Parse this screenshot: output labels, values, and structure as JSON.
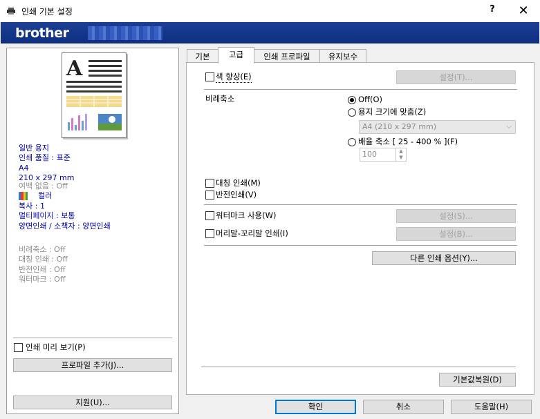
{
  "window": {
    "title": "인쇄 기본 설정",
    "help": "?",
    "close": "✕"
  },
  "banner": {
    "brand": "brother"
  },
  "summary": {
    "lines_blue": [
      "일반 용지",
      "인쇄 품질 : 표준",
      "A4",
      "210 x 297 mm"
    ],
    "borderless": "여백 없음 : Off",
    "color": "컬러",
    "lines_blue2": [
      "복사 : 1",
      "멀티페이지 : 보통",
      "양면인쇄 / 소책자 : 양면인쇄"
    ],
    "lines_gray": [
      "비례축소 : Off",
      "대칭 인쇄 : Off",
      "반전인쇄 : Off",
      "워터마크 : Off"
    ]
  },
  "left": {
    "print_preview": "인쇄 미리 보기(P)",
    "add_profile": "프로파일 추가(J)...",
    "support": "지원(U)..."
  },
  "tabs": [
    "기본",
    "고급",
    "인쇄 프로파일",
    "유지보수"
  ],
  "advanced": {
    "color_enhance": "색 향상(E)",
    "settings_t": "설정(T)...",
    "scaling_label": "비례축소",
    "scaling_off": "Off(O)",
    "fit_to_paper": "용지 크기에 맞춤(Z)",
    "paper_size": "A4 (210 x 297 mm)",
    "free_scale": "배율 축소 [ 25 - 400 % ](F)",
    "scale_value": "100",
    "mirror": "대칭 인쇄(M)",
    "reverse": "반전인쇄(V)",
    "watermark": "워터마크 사용(W)",
    "settings_s": "설정(S)...",
    "header_footer": "머리말-꼬리말 인쇄(I)",
    "settings_b": "설정(B)...",
    "other_options": "다른 인쇄 옵션(Y)...",
    "default": "기본값복원(D)"
  },
  "footer": {
    "ok": "확인",
    "cancel": "취소",
    "help": "도움말(H)"
  }
}
